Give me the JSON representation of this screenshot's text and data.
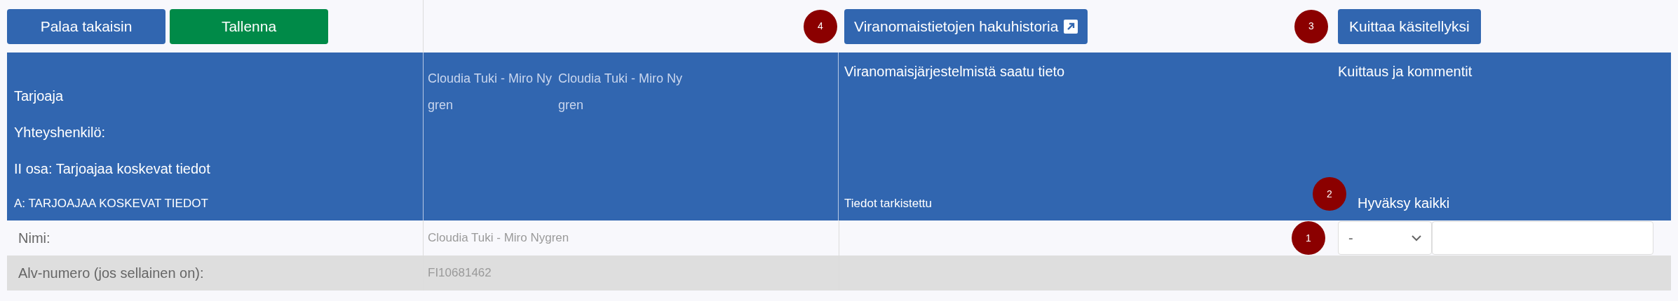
{
  "toolbar": {
    "buttons": [
      {
        "label": "Palaa takaisin",
        "kind": "primary"
      },
      {
        "label": "Tallenna",
        "kind": "success"
      }
    ]
  },
  "history_button": {
    "label": "Viranomaistietojen hakuhistoria",
    "badge": "4"
  },
  "acknowledge_button": {
    "label": "Kuittaa käsitellyksi",
    "badge": "3"
  },
  "header": {
    "column_1": [
      "Tarjoaja",
      "Yhteyshenkilö:",
      "II osa: Tarjoajaa koskevat tiedot"
    ],
    "section": "A: TARJOAJAA KOSKEVAT TIEDOT",
    "column_2": [
      "Cloudia Tuki - Miro Nygren",
      "Cloudia Tuki - Miro Nygren"
    ],
    "column_3": "Viranomaisjärjestelmistä saatu tieto",
    "column_3_footer": "Tiedot tarkistettu",
    "column_4": "Kuittaus ja kommentit",
    "approve_all": {
      "label": "Hyväksy kaikki",
      "badge": "2"
    }
  },
  "rows": [
    {
      "label": "Nimi:",
      "value": "Cloudia Tuki - Miro Nygren",
      "shaded": false,
      "review": {
        "choice": "-",
        "badge": "1"
      }
    },
    {
      "label": "Alv-numero (jos sellainen on):",
      "value": "FI10681462",
      "shaded": true
    }
  ]
}
